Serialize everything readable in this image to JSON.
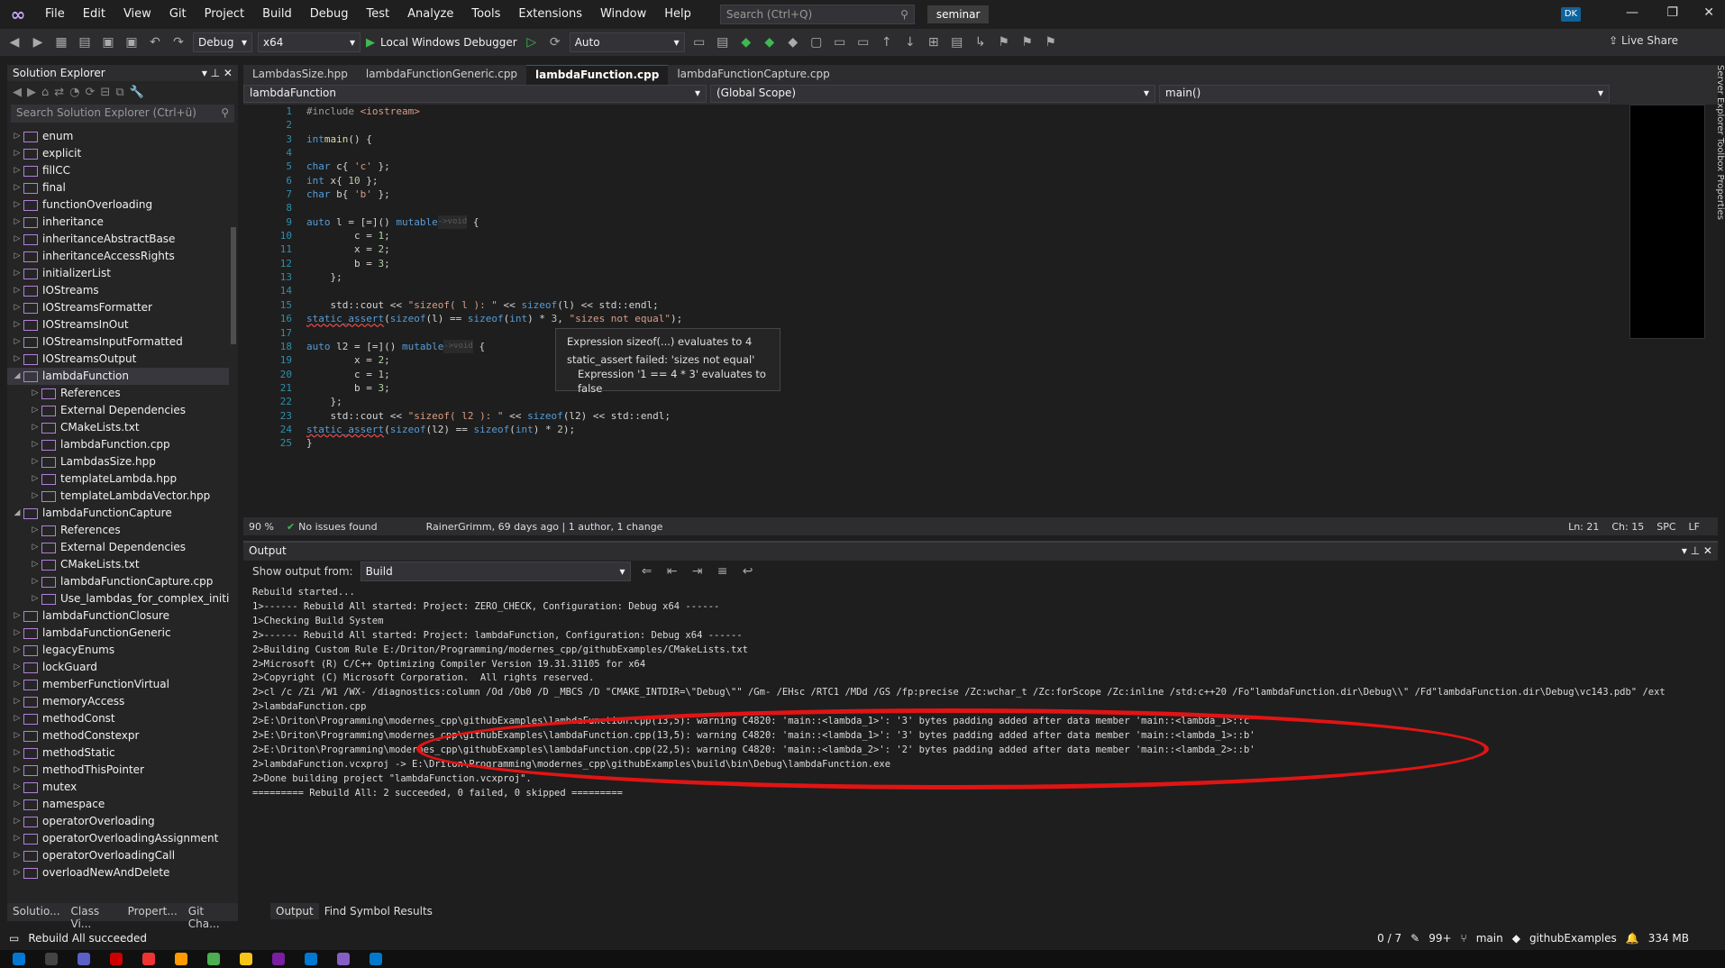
{
  "menu": [
    "File",
    "Edit",
    "View",
    "Git",
    "Project",
    "Build",
    "Debug",
    "Test",
    "Analyze",
    "Tools",
    "Extensions",
    "Window",
    "Help"
  ],
  "search_placeholder": "Search (Ctrl+Q)",
  "solution_name": "seminar",
  "user_initials": "DK",
  "toolbar": {
    "config": "Debug",
    "platform": "x64",
    "debugger": "Local Windows Debugger",
    "mode": "Auto",
    "live_share": "Live Share"
  },
  "solution_explorer": {
    "title": "Solution Explorer",
    "search": "Search Solution Explorer (Ctrl+ü)",
    "items": [
      {
        "label": "enum",
        "level": 0
      },
      {
        "label": "explicit",
        "level": 0
      },
      {
        "label": "fillCC",
        "level": 0
      },
      {
        "label": "final",
        "level": 0
      },
      {
        "label": "functionOverloading",
        "level": 0
      },
      {
        "label": "inheritance",
        "level": 0
      },
      {
        "label": "inheritanceAbstractBase",
        "level": 0
      },
      {
        "label": "inheritanceAccessRights",
        "level": 0
      },
      {
        "label": "initializerList",
        "level": 0
      },
      {
        "label": "IOStreams",
        "level": 0
      },
      {
        "label": "IOStreamsFormatter",
        "level": 0
      },
      {
        "label": "IOStreamsInOut",
        "level": 0
      },
      {
        "label": "IOStreamsInputFormatted",
        "level": 0
      },
      {
        "label": "IOStreamsOutput",
        "level": 0
      },
      {
        "label": "lambdaFunction",
        "level": 0
      },
      {
        "label": "References",
        "level": 1
      },
      {
        "label": "External Dependencies",
        "level": 1
      },
      {
        "label": "CMakeLists.txt",
        "level": 1
      },
      {
        "label": "lambdaFunction.cpp",
        "level": 1
      },
      {
        "label": "LambdasSize.hpp",
        "level": 1
      },
      {
        "label": "templateLambda.hpp",
        "level": 1
      },
      {
        "label": "templateLambdaVector.hpp",
        "level": 1
      },
      {
        "label": "lambdaFunctionCapture",
        "level": 0
      },
      {
        "label": "References",
        "level": 1
      },
      {
        "label": "External Dependencies",
        "level": 1
      },
      {
        "label": "CMakeLists.txt",
        "level": 1
      },
      {
        "label": "lambdaFunctionCapture.cpp",
        "level": 1
      },
      {
        "label": "Use_lambdas_for_complex_initi",
        "level": 1
      },
      {
        "label": "lambdaFunctionClosure",
        "level": 0
      },
      {
        "label": "lambdaFunctionGeneric",
        "level": 0
      },
      {
        "label": "legacyEnums",
        "level": 0
      },
      {
        "label": "lockGuard",
        "level": 0
      },
      {
        "label": "memberFunctionVirtual",
        "level": 0
      },
      {
        "label": "memoryAccess",
        "level": 0
      },
      {
        "label": "methodConst",
        "level": 0
      },
      {
        "label": "methodConstexpr",
        "level": 0
      },
      {
        "label": "methodStatic",
        "level": 0
      },
      {
        "label": "methodThisPointer",
        "level": 0
      },
      {
        "label": "mutex",
        "level": 0
      },
      {
        "label": "namespace",
        "level": 0
      },
      {
        "label": "operatorOverloading",
        "level": 0
      },
      {
        "label": "operatorOverloadingAssignment",
        "level": 0
      },
      {
        "label": "operatorOverloadingCall",
        "level": 0
      },
      {
        "label": "overloadNewAndDelete",
        "level": 0
      }
    ],
    "tabs": [
      "Solutio...",
      "Class Vi...",
      "Propert...",
      "Git Cha..."
    ]
  },
  "editor": {
    "tabs": [
      "LambdasSize.hpp",
      "lambdaFunctionGeneric.cpp",
      "lambdaFunction.cpp",
      "lambdaFunctionCapture.cpp"
    ],
    "nav": [
      "lambdaFunction",
      "(Global Scope)",
      "main()"
    ],
    "tooltip": {
      "l1": "Expression sizeof(...) evaluates to 4",
      "l2": "static_assert failed: 'sizes not equal'",
      "l3": "Expression '1 == 4 * 3' evaluates to false"
    },
    "status": {
      "zoom": "90 %",
      "issues": "No issues found",
      "git": "RainerGrimm, 69 days ago | 1 author, 1 change",
      "ln": "Ln: 21",
      "ch": "Ch: 15",
      "spc": "SPC",
      "lf": "LF"
    }
  },
  "output": {
    "title": "Output",
    "show_from": "Show output from:",
    "source": "Build",
    "lines": [
      "Rebuild started...",
      "1>------ Rebuild All started: Project: ZERO_CHECK, Configuration: Debug x64 ------",
      "1>Checking Build System",
      "2>------ Rebuild All started: Project: lambdaFunction, Configuration: Debug x64 ------",
      "2>Building Custom Rule E:/Driton/Programming/modernes_cpp/githubExamples/CMakeLists.txt",
      "2>Microsoft (R) C/C++ Optimizing Compiler Version 19.31.31105 for x64",
      "2>Copyright (C) Microsoft Corporation.  All rights reserved.",
      "2>cl /c /Zi /W1 /WX- /diagnostics:column /Od /Ob0 /D _MBCS /D \"CMAKE_INTDIR=\\\"Debug\\\"\" /Gm- /EHsc /RTC1 /MDd /GS /fp:precise /Zc:wchar_t /Zc:forScope /Zc:inline /std:c++20 /Fo\"lambdaFunction.dir\\Debug\\\\\" /Fd\"lambdaFunction.dir\\Debug\\vc143.pdb\" /ext",
      "2>lambdaFunction.cpp",
      "2>E:\\Driton\\Programming\\modernes_cpp\\githubExamples\\lambdaFunction.cpp(13,5): warning C4820: 'main::<lambda_1>': '3' bytes padding added after data member 'main::<lambda_1>::c'",
      "2>E:\\Driton\\Programming\\modernes_cpp\\githubExamples\\lambdaFunction.cpp(13,5): warning C4820: 'main::<lambda_1>': '3' bytes padding added after data member 'main::<lambda_1>::b'",
      "2>E:\\Driton\\Programming\\modernes_cpp\\githubExamples\\lambdaFunction.cpp(22,5): warning C4820: 'main::<lambda_2>': '2' bytes padding added after data member 'main::<lambda_2>::b'",
      "2>lambdaFunction.vcxproj -> E:\\Driton\\Programming\\modernes_cpp\\githubExamples\\build\\bin\\Debug\\lambdaFunction.exe",
      "2>Done building project \"lambdaFunction.vcxproj\".",
      "========= Rebuild All: 2 succeeded, 0 failed, 0 skipped ========="
    ],
    "tabs": [
      "Output",
      "Find Symbol Results"
    ]
  },
  "status": {
    "message": "Rebuild All succeeded",
    "lines": "0 / 7",
    "edits": "99+",
    "branch": "main",
    "repo": "githubExamples",
    "memory": "334 MB"
  },
  "right_tabs": "Server Explorer   Toolbox   Properties"
}
